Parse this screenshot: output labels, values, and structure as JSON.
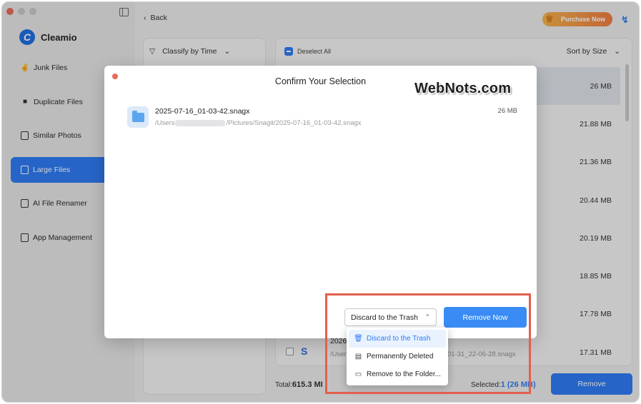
{
  "app": {
    "name": "Cleamio"
  },
  "sidebar": {
    "items": [
      {
        "label": "Junk Files",
        "icon": "broom-icon"
      },
      {
        "label": "Duplicate Files",
        "icon": "folder-icon"
      },
      {
        "label": "Similar Photos",
        "icon": "photo-icon"
      },
      {
        "label": "Large Files",
        "icon": "file-icon",
        "active": true
      },
      {
        "label": "AI File Renamer",
        "icon": "rename-icon"
      },
      {
        "label": "App Management",
        "icon": "app-icon"
      }
    ]
  },
  "header": {
    "back_label": "Back",
    "purchase_label": "Purchase Now"
  },
  "filters": {
    "classify_label": "Classify by Time",
    "deselect_label": "Deselect All",
    "sort_label": "Sort by Size"
  },
  "file_sizes": [
    "26  MB",
    "21.88  MB",
    "21.36  MB",
    "20.44  MB",
    "20.19  MB",
    "18.85  MB",
    "17.78  MB",
    "17.31  MB"
  ],
  "partial_row": {
    "name": "2026",
    "path_start": "/Users",
    "path_end": "01-31_22-06-28.snagx"
  },
  "footer": {
    "total_label": "Total:",
    "total_value": "615.3 MI",
    "selected_label": "Selected:",
    "selected_value": "1 (26  MB)",
    "remove_label": "Remove"
  },
  "modal": {
    "title": "Confirm Your Selection",
    "file": {
      "name": "2025-07-16_01-03-42.snagx",
      "path_prefix": "/Users",
      "path_suffix": "/Pictures/Snagit/2025-07-16_01-03-42.snagx",
      "size": "26  MB"
    },
    "action_selected": "Discard to the Trash",
    "remove_now_label": "Remove Now"
  },
  "dropdown": {
    "options": [
      {
        "label": "Discard to the Trash",
        "icon": "trash-icon",
        "active": true
      },
      {
        "label": "Permanently Deleted",
        "icon": "delete-file-icon"
      },
      {
        "label": "Remove to the Folder...",
        "icon": "folder-move-icon"
      }
    ]
  },
  "watermark": "WebNots.com",
  "colors": {
    "accent": "#2f7cf3",
    "highlight": "#e35f4d",
    "purchase_start": "#f2b24c",
    "purchase_end": "#f07c43"
  }
}
